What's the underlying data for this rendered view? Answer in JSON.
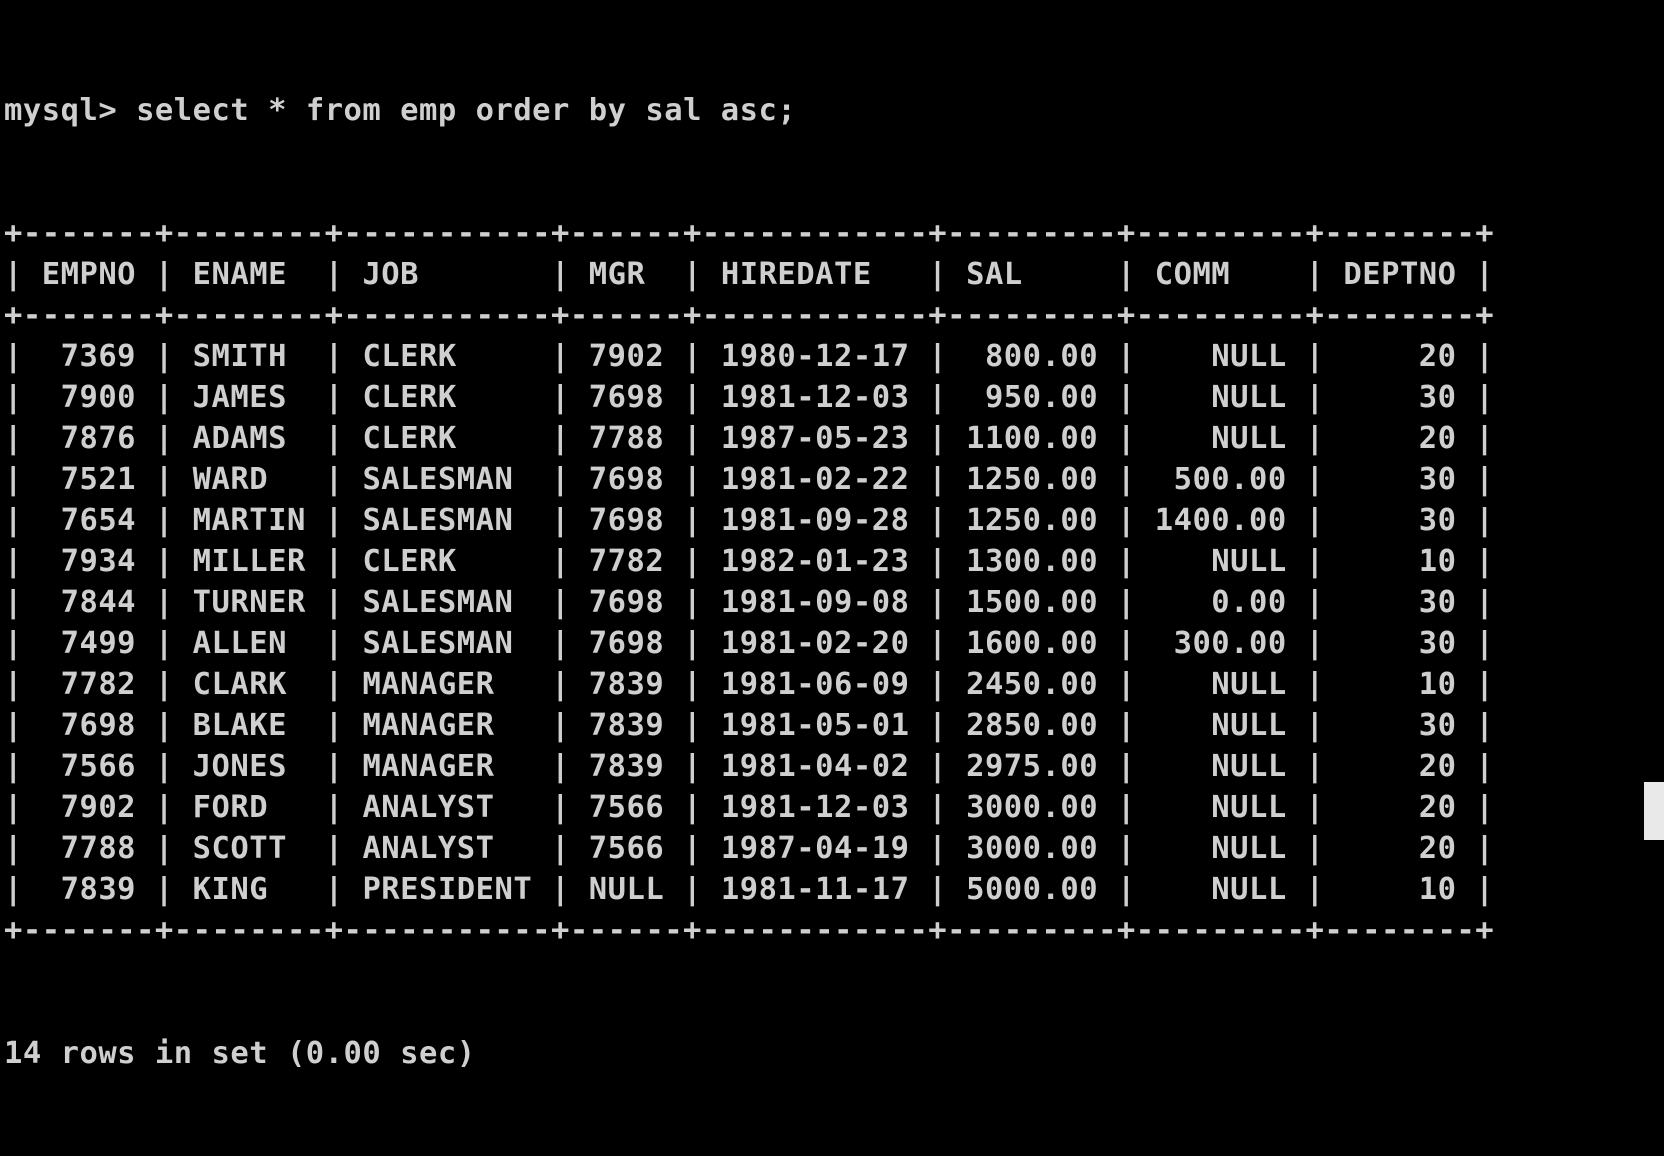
{
  "console": {
    "prompt": "mysql>",
    "command": "select * from emp order by sal asc;",
    "columns": [
      "EMPNO",
      "ENAME",
      "JOB",
      "MGR",
      "HIREDATE",
      "SAL",
      "COMM",
      "DEPTNO"
    ],
    "column_align": [
      "right",
      "left",
      "left",
      "left",
      "left",
      "right",
      "right",
      "right"
    ],
    "rows": [
      [
        "7369",
        "SMITH",
        "CLERK",
        "7902",
        "1980-12-17",
        "800.00",
        "NULL",
        "20"
      ],
      [
        "7900",
        "JAMES",
        "CLERK",
        "7698",
        "1981-12-03",
        "950.00",
        "NULL",
        "30"
      ],
      [
        "7876",
        "ADAMS",
        "CLERK",
        "7788",
        "1987-05-23",
        "1100.00",
        "NULL",
        "20"
      ],
      [
        "7521",
        "WARD",
        "SALESMAN",
        "7698",
        "1981-02-22",
        "1250.00",
        "500.00",
        "30"
      ],
      [
        "7654",
        "MARTIN",
        "SALESMAN",
        "7698",
        "1981-09-28",
        "1250.00",
        "1400.00",
        "30"
      ],
      [
        "7934",
        "MILLER",
        "CLERK",
        "7782",
        "1982-01-23",
        "1300.00",
        "NULL",
        "10"
      ],
      [
        "7844",
        "TURNER",
        "SALESMAN",
        "7698",
        "1981-09-08",
        "1500.00",
        "0.00",
        "30"
      ],
      [
        "7499",
        "ALLEN",
        "SALESMAN",
        "7698",
        "1981-02-20",
        "1600.00",
        "300.00",
        "30"
      ],
      [
        "7782",
        "CLARK",
        "MANAGER",
        "7839",
        "1981-06-09",
        "2450.00",
        "NULL",
        "10"
      ],
      [
        "7698",
        "BLAKE",
        "MANAGER",
        "7839",
        "1981-05-01",
        "2850.00",
        "NULL",
        "30"
      ],
      [
        "7566",
        "JONES",
        "MANAGER",
        "7839",
        "1981-04-02",
        "2975.00",
        "NULL",
        "20"
      ],
      [
        "7902",
        "FORD",
        "ANALYST",
        "7566",
        "1981-12-03",
        "3000.00",
        "NULL",
        "20"
      ],
      [
        "7788",
        "SCOTT",
        "ANALYST",
        "7566",
        "1987-04-19",
        "3000.00",
        "NULL",
        "20"
      ],
      [
        "7839",
        "KING",
        "PRESIDENT",
        "NULL",
        "1981-11-17",
        "5000.00",
        "NULL",
        "10"
      ]
    ],
    "result_summary": "14 rows in set (0.00 sec)"
  },
  "colors": {
    "background": "#000000",
    "text": "#cfcfcf",
    "scrollbar_thumb": "#e9e9e9"
  }
}
